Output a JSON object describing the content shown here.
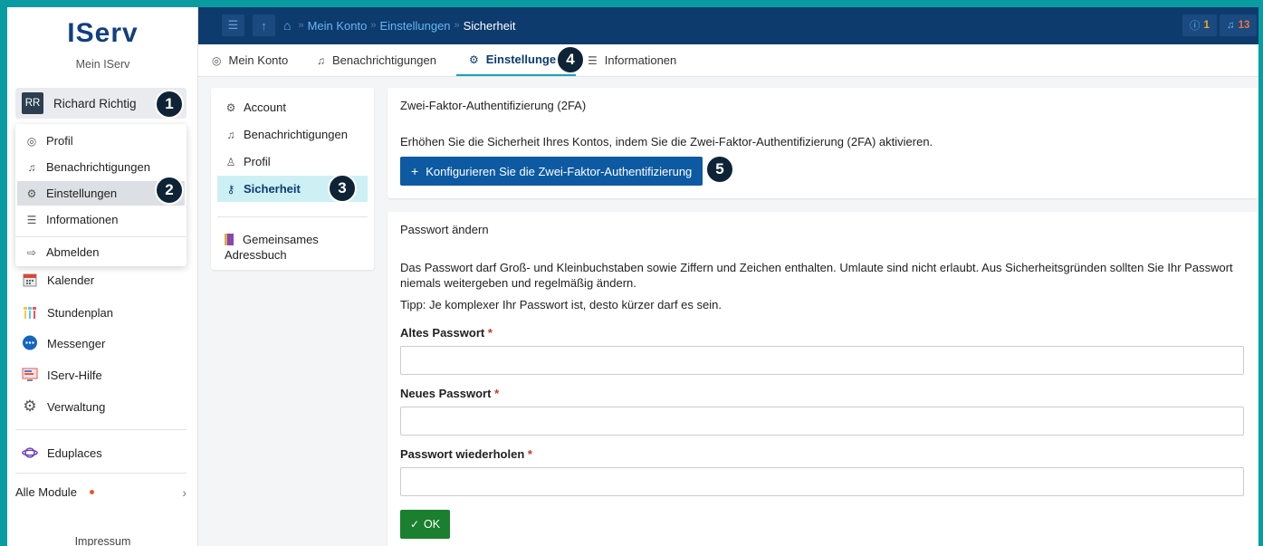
{
  "sidebar": {
    "logo_text": "IServ",
    "subtitle": "Mein IServ",
    "user": {
      "initials": "RR",
      "name": "Richard Richtig"
    },
    "dropdown": [
      {
        "label": "Profil",
        "icon": "user-circle-icon"
      },
      {
        "label": "Benachrichtigungen",
        "icon": "bell-icon"
      },
      {
        "label": "Einstellungen",
        "icon": "gear-icon",
        "active": true
      },
      {
        "label": "Informationen",
        "icon": "list-icon"
      },
      {
        "label": "Abmelden",
        "icon": "logout-icon"
      }
    ],
    "modules": [
      {
        "label": "Kalender",
        "icon": "calendar-icon"
      },
      {
        "label": "Stundenplan",
        "icon": "timetable-icon"
      },
      {
        "label": "Messenger",
        "icon": "chat-bubble-icon"
      },
      {
        "label": "IServ-Hilfe",
        "icon": "help-screen-icon"
      },
      {
        "label": "Verwaltung",
        "icon": "gear-icon"
      },
      {
        "label": "Eduplaces",
        "icon": "planet-icon"
      }
    ],
    "all_modules": "Alle Module",
    "impressum": "Impressum"
  },
  "topbar": {
    "breadcrumb": [
      "Mein Konto",
      "Einstellungen",
      "Sicherheit"
    ],
    "info_count": "1",
    "notification_count": "13"
  },
  "tabs": [
    {
      "label": "Mein Konto",
      "icon": "user-circle-icon"
    },
    {
      "label": "Benachrichtigungen",
      "icon": "bell-icon"
    },
    {
      "label": "Einstellungen",
      "icon": "gear-icon",
      "active": true
    },
    {
      "label": "Informationen",
      "icon": "list-icon"
    }
  ],
  "settings_nav": {
    "items": [
      {
        "label": "Account",
        "icon": "gear-icon"
      },
      {
        "label": "Benachrichtigungen",
        "icon": "bell-icon"
      },
      {
        "label": "Profil",
        "icon": "user-icon"
      },
      {
        "label": "Sicherheit",
        "icon": "key-icon",
        "active": true
      }
    ],
    "addressbook": "Gemeinsames Adressbuch"
  },
  "twofa": {
    "title": "Zwei-Faktor-Authentifizierung (2FA)",
    "text": "Erhöhen Sie die Sicherheit Ihres Kontos, indem Sie die Zwei-Faktor-Authentifizierung (2FA) aktivieren.",
    "button": "Konfigurieren Sie die Zwei-Faktor-Authentifizierung"
  },
  "password": {
    "title": "Passwort ändern",
    "text": "Das Passwort darf Groß- und Kleinbuchstaben sowie Ziffern und Zeichen enthalten. Umlaute sind nicht erlaubt. Aus Sicherheitsgründen sollten Sie Ihr Passwort niemals weitergeben und regelmäßig ändern.",
    "tip": "Tipp: Je komplexer Ihr Passwort ist, desto kürzer darf es sein.",
    "old_label": "Altes Passwort",
    "new_label": "Neues Passwort",
    "repeat_label": "Passwort wiederholen",
    "required_mark": "*",
    "ok_button": "OK"
  },
  "steps": [
    "1",
    "2",
    "3",
    "4",
    "5"
  ],
  "colors": {
    "background": "#0a9ba1",
    "topbar": "#0d3b6e",
    "primary_button": "#0d5aa3",
    "ok_button": "#1a7f2e",
    "active_nav": "#cdf0f5",
    "step_marker": "#0e2436"
  }
}
